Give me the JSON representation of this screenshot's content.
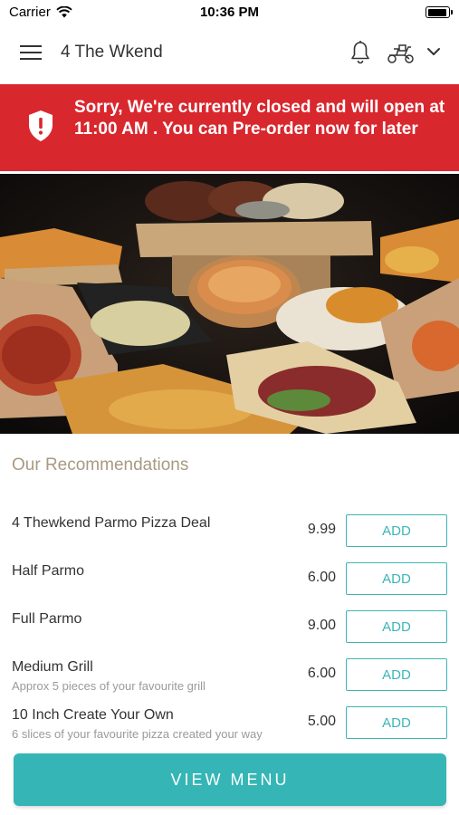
{
  "status_bar": {
    "carrier": "Carrier",
    "time": "10:36 PM"
  },
  "header": {
    "title": "4 The Wkend",
    "icons": [
      "menu-icon",
      "bell-icon",
      "scooter-icon",
      "chevron-down-icon"
    ]
  },
  "banner": {
    "message": "Sorry, We're currently closed and will open at 11:00 AM . You can Pre-order now for later",
    "icon": "shield-alert-icon",
    "color": "#d9272e"
  },
  "recommendations": {
    "title": "Our Recommendations",
    "items": [
      {
        "name": "4 Thewkend Parmo Pizza Deal",
        "description": "",
        "price": "9.99",
        "button": "ADD"
      },
      {
        "name": "Half Parmo",
        "description": "",
        "price": "6.00",
        "button": "ADD"
      },
      {
        "name": "Full Parmo",
        "description": "",
        "price": "9.00",
        "button": "ADD"
      },
      {
        "name": "Medium Grill",
        "description": "Approx 5 pieces of your favourite grill",
        "price": "6.00",
        "button": "ADD"
      },
      {
        "name": "10 Inch Create Your Own",
        "description": "6 slices of your favourite pizza created your way",
        "price": "5.00",
        "button": "ADD"
      }
    ]
  },
  "footer": {
    "view_menu": "VIEW MENU"
  },
  "colors": {
    "accent": "#35b5b5",
    "banner": "#d9272e",
    "section_title": "#a89a82"
  }
}
